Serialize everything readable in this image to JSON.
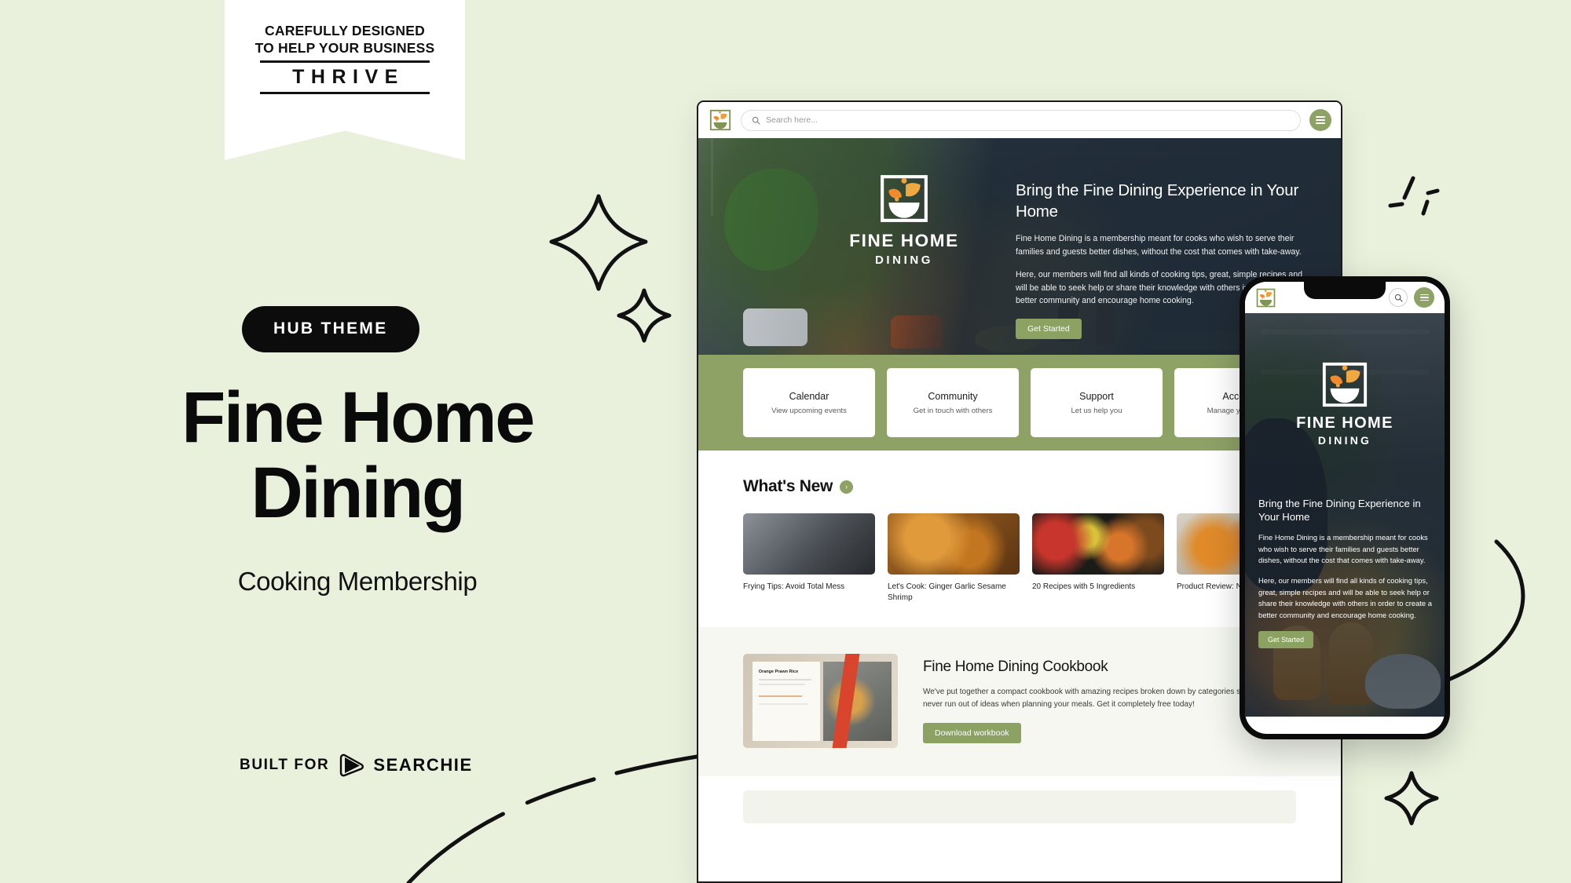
{
  "theme": {
    "bg": "#e9f0dc",
    "accent_green": "#8ea266",
    "dark": "#0c0c0c",
    "hero_dark": "#2a3641"
  },
  "ribbon": {
    "line1": "CAREFULLY DESIGNED",
    "line2": "TO HELP YOUR BUSINESS",
    "wordmark": "THRIVE"
  },
  "promo": {
    "badge": "HUB THEME",
    "headline_line1": "Fine Home",
    "headline_line2": "Dining",
    "subtitle": "Cooking Membership",
    "built_for_label": "BUILT FOR",
    "built_for_brand": "SEARCHIE"
  },
  "browser": {
    "topbar": {
      "logo_alt": "fine-home-dining-logo",
      "search_placeholder": "Search here...",
      "search_value": "",
      "menu_label": "Menu"
    },
    "hero": {
      "logo_word1": "FINE HOME",
      "logo_word2": "DINING",
      "title": "Bring the Fine Dining Experience in Your Home",
      "paragraph1": "Fine Home Dining is a membership meant for cooks who wish to serve their families and guests better dishes, without the cost that comes with take-away.",
      "paragraph2": "Here, our members will find all kinds of cooking tips, great, simple recipes and will be able to seek help or share their knowledge with others in order to create a better community and encourage home cooking.",
      "cta": "Get Started"
    },
    "nav_cards": [
      {
        "title": "Calendar",
        "subtitle": "View upcoming events"
      },
      {
        "title": "Community",
        "subtitle": "Get in touch with others"
      },
      {
        "title": "Support",
        "subtitle": "Let us help you"
      },
      {
        "title": "Account",
        "subtitle": "Manage your profile"
      }
    ],
    "whats_new": {
      "title": "What's New",
      "arrow": "›",
      "items": [
        {
          "caption": "Frying Tips: Avoid Total Mess"
        },
        {
          "caption": "Let's Cook: Ginger Garlic Sesame Shrimp"
        },
        {
          "caption": "20 Recipes with 5 Ingredients"
        },
        {
          "caption": "Product Review: Nutribullet"
        }
      ]
    },
    "cookbook": {
      "image_page_title": "Orange Prawn Rice",
      "title": "Fine Home Dining Cookbook",
      "paragraph": "We've put together a compact cookbook with amazing recipes broken down by categories so you never run out of ideas when planning your meals. Get it completely free today!",
      "cta": "Download workbook"
    }
  },
  "phone": {
    "topbar": {
      "logo_alt": "fine-home-dining-logo",
      "search_label": "Search",
      "menu_label": "Menu"
    },
    "hero": {
      "logo_word1": "FINE HOME",
      "logo_word2": "DINING",
      "title": "Bring the Fine Dining Experience in Your Home",
      "paragraph1": "Fine Home Dining is a membership meant for cooks who wish to serve their families and guests better dishes, without the cost that comes with take-away.",
      "paragraph2": "Here, our members will find all kinds of cooking tips, great, simple recipes and will be able to seek help or share their knowledge with others in order to create a better community and encourage home cooking.",
      "cta": "Get Started"
    }
  }
}
